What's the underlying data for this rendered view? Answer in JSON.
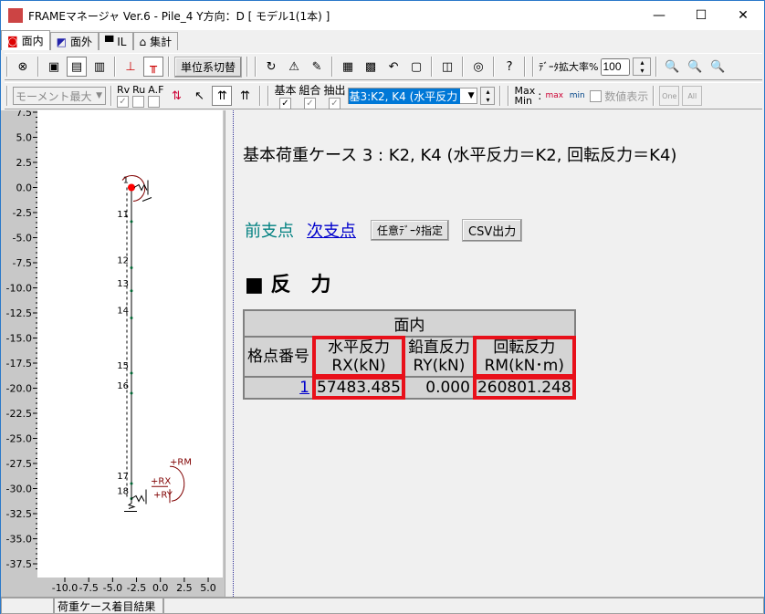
{
  "window": {
    "title": "FRAMEマネージャ Ver.6 - Pile_4 Y方向：D [ モデル1(1本) ]",
    "minimize": "—",
    "maximize": "☐",
    "close": "✕"
  },
  "tabs": [
    {
      "label": "面内",
      "active": true
    },
    {
      "label": "面外"
    },
    {
      "label": "IL"
    },
    {
      "label": "集計"
    }
  ],
  "toolbar1": {
    "unit_switch": "単位系切替",
    "zoom_label": "ﾃﾞｰﾀ拡大率%",
    "zoom_value": "100"
  },
  "toolbar2": {
    "mode_select": "モーメント最大",
    "rv": "Rv",
    "ru": "Ru",
    "af": "A.F",
    "kihon": "基本",
    "kumiai": "組合",
    "chushutsu": "抽出",
    "case_select": "基3:K2, K4 (水平反力",
    "max": "Max",
    "min": "Min",
    "max_btn": "max",
    "min_btn": "min",
    "show_values": "数値表示",
    "one": "One",
    "all": "All"
  },
  "graph": {
    "y_ticks": [
      "7.5",
      "5.0",
      "2.5",
      "0.0",
      "-2.5",
      "-5.0",
      "-7.5",
      "-10.0",
      "-12.5",
      "-15.0",
      "-17.5",
      "-20.0",
      "-22.5",
      "-25.0",
      "-27.5",
      "-30.0",
      "-32.5",
      "-35.0",
      "-37.5"
    ],
    "x_ticks": [
      "-10.0",
      "-7.5",
      "-5.0",
      "-2.5",
      "0.0",
      "2.5",
      "5.0"
    ],
    "nodes": [
      {
        "label": "1",
        "y": 0.0
      },
      {
        "label": "11",
        "y": -3.4
      },
      {
        "label": "12",
        "y": -8.0
      },
      {
        "label": "13",
        "y": -10.3
      },
      {
        "label": "14",
        "y": -13.0
      },
      {
        "label": "15",
        "y": -18.5
      },
      {
        "label": "16",
        "y": -20.5
      },
      {
        "label": "17",
        "y": -29.5
      },
      {
        "label": "18",
        "y": -31.0
      }
    ],
    "legend": {
      "rm": "+RM",
      "rx": "+RX",
      "ry": "+RY"
    },
    "color": "#800000"
  },
  "main": {
    "caption": "基本荷重ケース 3 : K2, K4 (水平反力＝K2, 回転反力＝K4)",
    "prev": "前支点",
    "next": "次支点",
    "custom_btn": "任意ﾃﾞｰﾀ指定",
    "csv_btn": "CSV出力",
    "section": "■ 反　力",
    "table": {
      "group": "面内",
      "headers": [
        "格点番号",
        [
          "水平反力",
          "RX(kN)"
        ],
        [
          "鉛直反力",
          "RY(kN)"
        ],
        [
          "回転反力",
          "RM(kN･m)"
        ]
      ],
      "rows": [
        [
          "1",
          "57483.485",
          "0.000",
          "260801.248"
        ]
      ]
    }
  },
  "status": {
    "text": "荷重ケース着目結果"
  }
}
